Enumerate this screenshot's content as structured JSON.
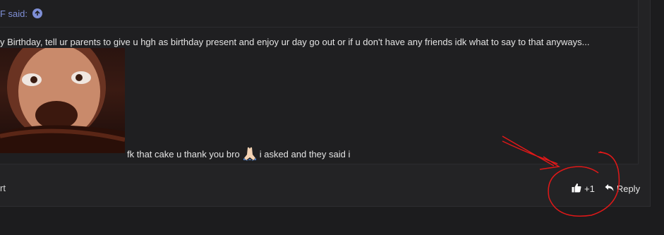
{
  "quote": {
    "attribution": "F said:",
    "text": "y Birthday, tell ur parents to give u hgh as birthday present and enjoy ur day go out or if u don't have any friends idk what to say to that anyways..."
  },
  "reply": {
    "before_emoji": "fk that cake u thank you bro",
    "after_emoji": "i asked and they said i"
  },
  "footer": {
    "left_fragment": "rt",
    "like_count": "+1",
    "reply_label": "Reply"
  },
  "icons": {
    "expand": "arrow-up-circle-icon",
    "like": "thumbs-up-icon",
    "reply": "reply-arrow-icon",
    "emoji": "praying-hands-emoji"
  },
  "colors": {
    "background": "#1c1c1e",
    "post_bg": "#232325",
    "link": "#7f8fd6",
    "annotation": "#e01818"
  }
}
